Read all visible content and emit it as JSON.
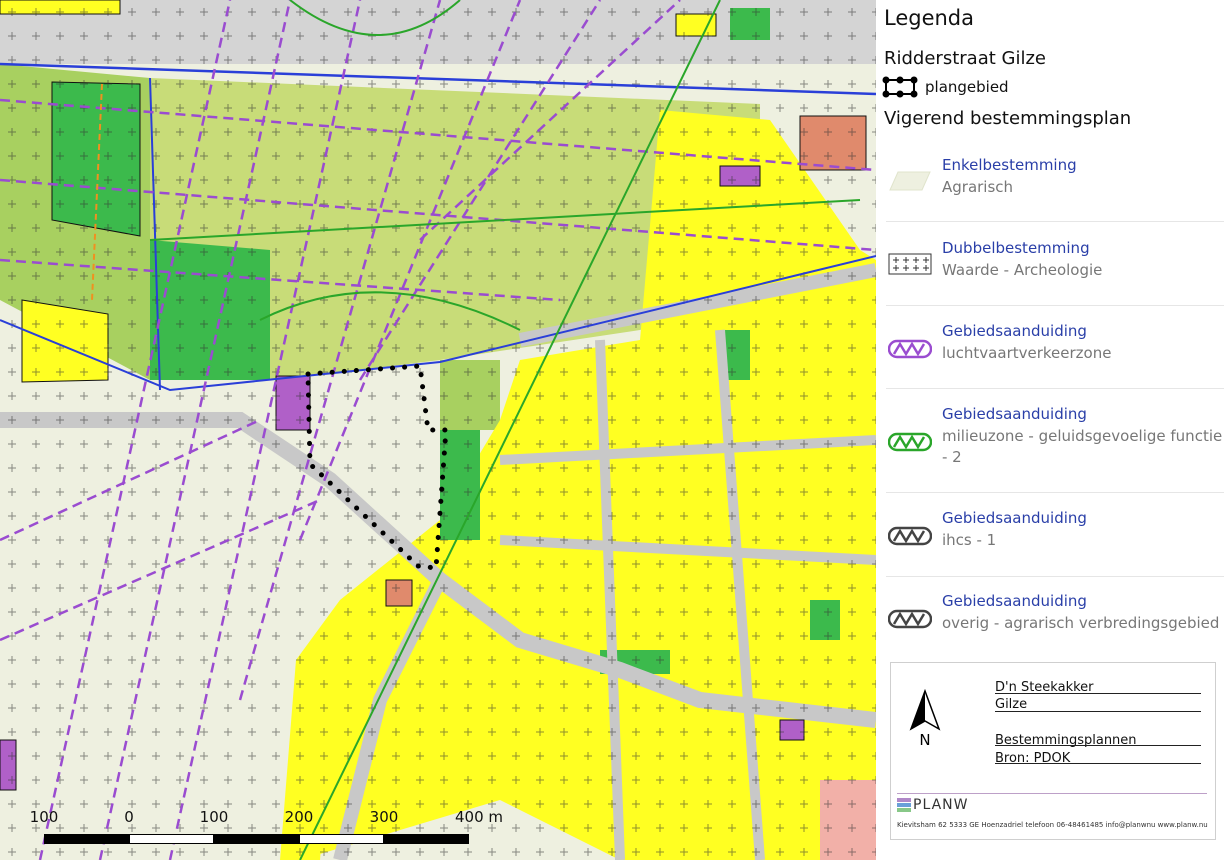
{
  "map": {
    "scale_bar": {
      "labels": [
        "100",
        "0",
        "100",
        "200",
        "300",
        "400 m"
      ]
    },
    "colors": {
      "agrarisch": "#eef0e0",
      "groen_light": "#c8dc78",
      "groen_mid": "#a8d060",
      "groen_dark": "#3cba4c",
      "wonen": "#ffff22",
      "road": "#c8c8c8",
      "bedrijf": "#b060c8",
      "horeca": "#e08a6c",
      "luchtvaart": "#9a4cd0",
      "milieuzone": "#2aa62a",
      "plangebied": "#000000",
      "blue_line": "#2a3fd8"
    }
  },
  "legend": {
    "title": "Legenda",
    "project": "Ridderstraat Gilze",
    "plangebied_label": "plangebied",
    "section": "Vigerend bestemmingsplan",
    "items": [
      {
        "head": "Enkelbestemming",
        "sub": "Agrarisch",
        "swatch": "agrarisch-swatch-icon"
      },
      {
        "head": "Dubbelbestemming",
        "sub": "Waarde - Archeologie",
        "swatch": "archeologie-swatch-icon"
      },
      {
        "head": "Gebiedsaanduiding",
        "sub": "luchtvaartverkeerzone",
        "swatch": "luchtvaart-swatch-icon"
      },
      {
        "head": "Gebiedsaanduiding",
        "sub": "milieuzone - geluidsgevoelige functie - 2",
        "swatch": "milieuzone-swatch-icon"
      },
      {
        "head": "Gebiedsaanduiding",
        "sub": "ihcs - 1",
        "swatch": "ihcs-swatch-icon"
      },
      {
        "head": "Gebiedsaanduiding",
        "sub": "overig - agrarisch verbredingsgebied",
        "swatch": "overig-swatch-icon"
      }
    ],
    "info": {
      "line1": "D'n Steekakker",
      "line2": "Gilze",
      "line3": "Bestemmingsplannen",
      "line4": "Bron: PDOK",
      "north": "N",
      "brand": "PLANW",
      "footer": "Kievitsham 62 5333 GE Hoenzadriel telefoon 06-48461485 info@planwnu www.planw.nu"
    }
  }
}
